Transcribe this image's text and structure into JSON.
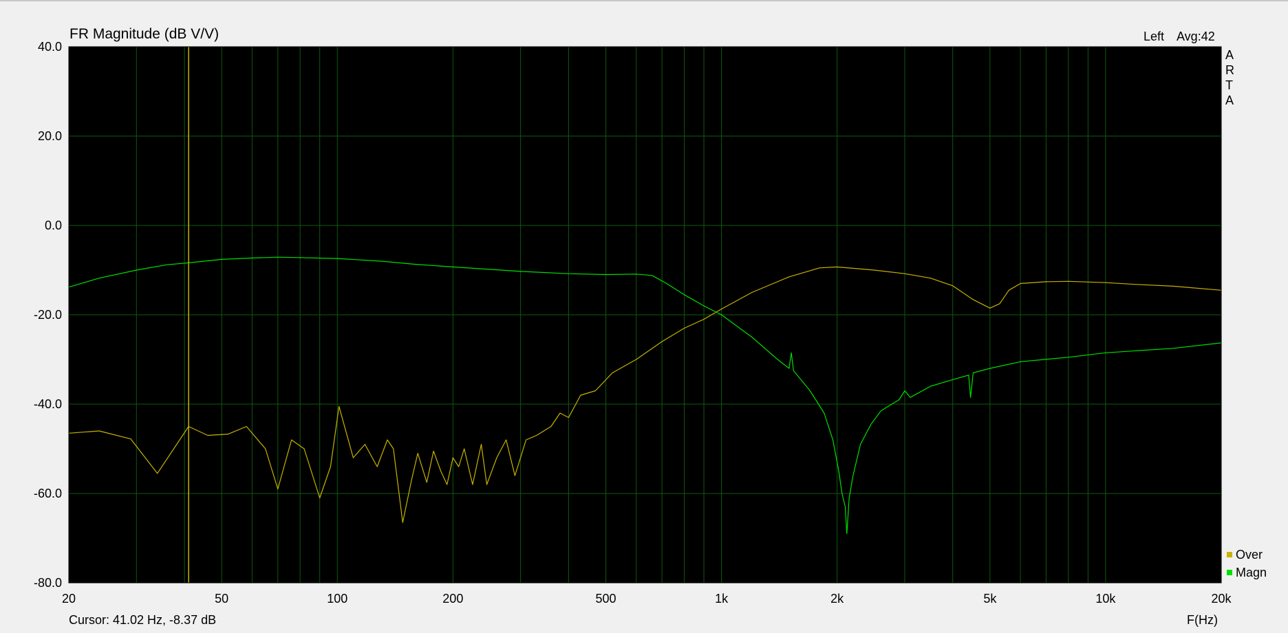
{
  "chart_data": {
    "type": "line",
    "title": "FR Magnitude (dB V/V)",
    "info": {
      "channel": "Left",
      "avg": "Avg:42"
    },
    "brand": [
      "A",
      "R",
      "T",
      "A"
    ],
    "xlabel": "F(Hz)",
    "cursor_text": "Cursor: 41.02 Hz, -8.37 dB",
    "x_scale": "log",
    "xlim": [
      20,
      20000
    ],
    "ylim": [
      -80,
      40
    ],
    "grid": true,
    "legend_position": "bottom-right",
    "x_ticks": [
      {
        "value": 20,
        "label": "20"
      },
      {
        "value": 50,
        "label": "50"
      },
      {
        "value": 100,
        "label": "100"
      },
      {
        "value": 200,
        "label": "200"
      },
      {
        "value": 500,
        "label": "500"
      },
      {
        "value": 1000,
        "label": "1k"
      },
      {
        "value": 2000,
        "label": "2k"
      },
      {
        "value": 5000,
        "label": "5k"
      },
      {
        "value": 10000,
        "label": "10k"
      },
      {
        "value": 20000,
        "label": "20k"
      }
    ],
    "y_ticks": [
      {
        "value": 40,
        "label": "40.0"
      },
      {
        "value": 20,
        "label": "20.0"
      },
      {
        "value": 0,
        "label": "0.0"
      },
      {
        "value": -20,
        "label": "-20.0"
      },
      {
        "value": -40,
        "label": "-40.0"
      },
      {
        "value": -60,
        "label": "-60.0"
      },
      {
        "value": -80,
        "label": "-80.0"
      }
    ],
    "cursor_x": 41.02,
    "colors": {
      "plot_bg": "#000000",
      "grid": "#0f5a0f",
      "frame": "#000000",
      "over": "#c8b400",
      "magn": "#00e000",
      "cursor": "#c8b400",
      "page_bg": "#f0f0f0"
    },
    "series": [
      {
        "name": "Over",
        "color": "#c8b400",
        "points": [
          [
            20,
            -46.5
          ],
          [
            24,
            -46
          ],
          [
            29,
            -47.8
          ],
          [
            34,
            -55.5
          ],
          [
            41,
            -45
          ],
          [
            46,
            -47
          ],
          [
            52,
            -46.7
          ],
          [
            58,
            -45
          ],
          [
            65,
            -50
          ],
          [
            70,
            -59
          ],
          [
            76,
            -48
          ],
          [
            82,
            -50
          ],
          [
            90,
            -61
          ],
          [
            96,
            -54
          ],
          [
            101,
            -40.5
          ],
          [
            110,
            -52
          ],
          [
            118,
            -49
          ],
          [
            127,
            -54
          ],
          [
            135,
            -48
          ],
          [
            140,
            -50
          ],
          [
            148,
            -66.5
          ],
          [
            156,
            -57
          ],
          [
            162,
            -51
          ],
          [
            171,
            -57.5
          ],
          [
            178,
            -50.5
          ],
          [
            186,
            -55
          ],
          [
            193,
            -58
          ],
          [
            200,
            -52
          ],
          [
            207,
            -54
          ],
          [
            214,
            -50
          ],
          [
            225,
            -58
          ],
          [
            237,
            -49
          ],
          [
            245,
            -58
          ],
          [
            260,
            -52
          ],
          [
            275,
            -48
          ],
          [
            290,
            -56
          ],
          [
            310,
            -48
          ],
          [
            330,
            -47
          ],
          [
            360,
            -45
          ],
          [
            380,
            -42
          ],
          [
            400,
            -43
          ],
          [
            430,
            -38
          ],
          [
            470,
            -37
          ],
          [
            520,
            -33
          ],
          [
            600,
            -30
          ],
          [
            700,
            -26
          ],
          [
            800,
            -23
          ],
          [
            900,
            -21
          ],
          [
            1000,
            -18.7
          ],
          [
            1200,
            -15
          ],
          [
            1500,
            -11.5
          ],
          [
            1800,
            -9.5
          ],
          [
            2000,
            -9.3
          ],
          [
            2500,
            -10
          ],
          [
            3000,
            -10.8
          ],
          [
            3500,
            -11.8
          ],
          [
            4000,
            -13.5
          ],
          [
            4500,
            -16.5
          ],
          [
            5000,
            -18.5
          ],
          [
            5300,
            -17.5
          ],
          [
            5600,
            -14.5
          ],
          [
            6000,
            -13
          ],
          [
            7000,
            -12.6
          ],
          [
            8000,
            -12.5
          ],
          [
            10000,
            -12.8
          ],
          [
            12000,
            -13.2
          ],
          [
            15000,
            -13.6
          ],
          [
            20000,
            -14.5
          ]
        ]
      },
      {
        "name": "Magn",
        "color": "#00e000",
        "points": [
          [
            20,
            -13.8
          ],
          [
            24,
            -11.8
          ],
          [
            30,
            -10
          ],
          [
            36,
            -8.8
          ],
          [
            41,
            -8.37
          ],
          [
            50,
            -7.6
          ],
          [
            60,
            -7.3
          ],
          [
            70,
            -7.1
          ],
          [
            80,
            -7.2
          ],
          [
            100,
            -7.4
          ],
          [
            130,
            -8
          ],
          [
            160,
            -8.7
          ],
          [
            200,
            -9.3
          ],
          [
            300,
            -10.3
          ],
          [
            400,
            -10.8
          ],
          [
            500,
            -11
          ],
          [
            600,
            -10.9
          ],
          [
            660,
            -11.2
          ],
          [
            720,
            -13
          ],
          [
            800,
            -15.5
          ],
          [
            900,
            -18
          ],
          [
            1000,
            -20
          ],
          [
            1200,
            -25
          ],
          [
            1400,
            -30
          ],
          [
            1500,
            -32
          ],
          [
            1520,
            -28.5
          ],
          [
            1540,
            -32.5
          ],
          [
            1700,
            -37
          ],
          [
            1850,
            -42
          ],
          [
            1950,
            -48
          ],
          [
            2020,
            -55
          ],
          [
            2060,
            -60
          ],
          [
            2100,
            -63
          ],
          [
            2120,
            -69
          ],
          [
            2150,
            -61
          ],
          [
            2200,
            -56
          ],
          [
            2300,
            -49
          ],
          [
            2450,
            -44.5
          ],
          [
            2600,
            -41.5
          ],
          [
            2900,
            -39
          ],
          [
            3000,
            -37
          ],
          [
            3100,
            -38.5
          ],
          [
            3500,
            -36
          ],
          [
            4000,
            -34.5
          ],
          [
            4400,
            -33.5
          ],
          [
            4450,
            -38.5
          ],
          [
            4520,
            -33
          ],
          [
            5000,
            -32
          ],
          [
            6000,
            -30.5
          ],
          [
            8000,
            -29.5
          ],
          [
            10000,
            -28.5
          ],
          [
            15000,
            -27.5
          ],
          [
            20000,
            -26.3
          ]
        ]
      }
    ]
  }
}
